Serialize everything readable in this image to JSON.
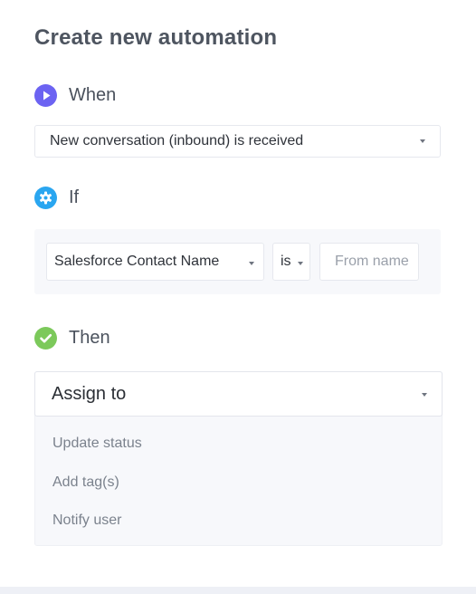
{
  "title": "Create new automation",
  "when": {
    "label": "When",
    "trigger_value": "New conversation (inbound) is received"
  },
  "if": {
    "label": "If",
    "field_value": "Salesforce Contact Name",
    "operator_value": "is",
    "input_placeholder": "From name"
  },
  "then": {
    "label": "Then",
    "action_value": "Assign to",
    "options": [
      "Update status",
      "Add tag(s)",
      "Notify user"
    ]
  },
  "colors": {
    "when_icon": "#6c63f2",
    "if_icon": "#2aa6f0",
    "then_icon": "#7cc95b"
  }
}
